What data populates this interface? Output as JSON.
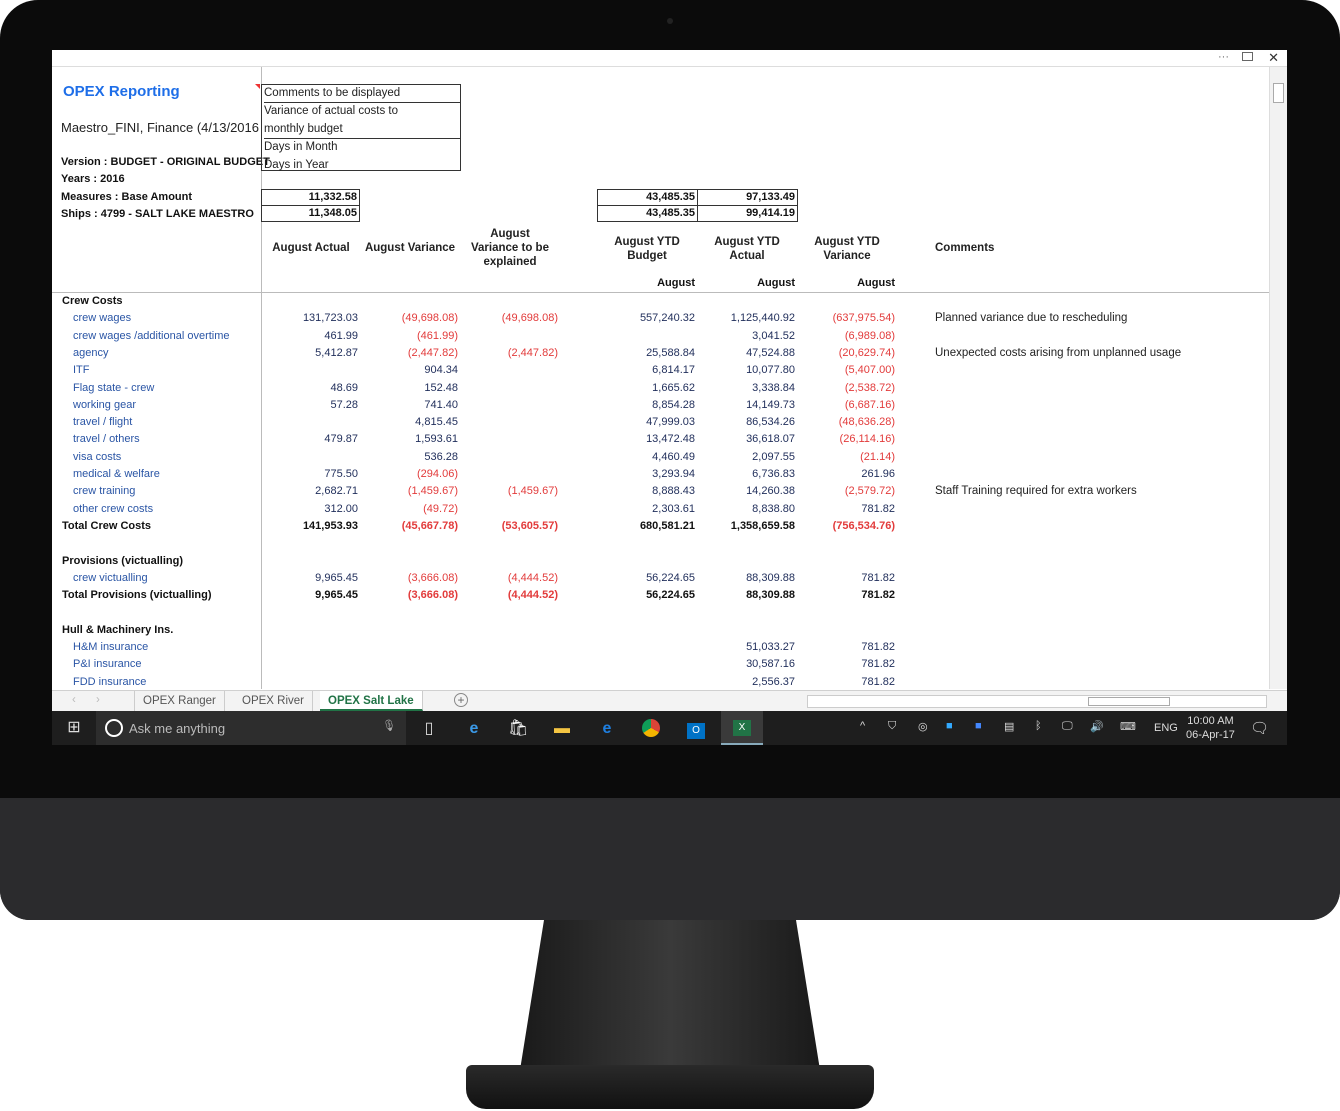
{
  "window": {
    "title_controls": [
      "...",
      "restore",
      "close"
    ]
  },
  "sheet": {
    "title": "OPEX Reporting",
    "subtitle": "Maestro_FINI, Finance (4/13/2016",
    "version": "Version : BUDGET - ORIGINAL BUDGET",
    "years": "Years : 2016",
    "measures": "Measures : Base Amount",
    "ships": "Ships : 4799 -  SALT LAKE MAESTRO",
    "legend": [
      "Comments to be displayed",
      "Variance of actual costs to",
      "monthly budget",
      "Days in Month",
      "Days in Year"
    ],
    "days_boxes": [
      "11,332.58",
      "11,348.05"
    ],
    "ytd_boxes": [
      [
        "43,485.35",
        "97,133.49"
      ],
      [
        "43,485.35",
        "99,414.19"
      ]
    ],
    "headers": {
      "actual": "August Actual",
      "variance": "August Variance",
      "explain": [
        "August",
        "Variance to be",
        "explained"
      ],
      "ytd_budget": [
        "August YTD",
        "Budget"
      ],
      "ytd_actual": [
        "August YTD",
        "Actual"
      ],
      "ytd_variance": [
        "August YTD",
        "Variance"
      ],
      "comments": "Comments",
      "sub": "August"
    },
    "rows": [
      {
        "label": "Crew Costs",
        "type": "section"
      },
      {
        "label": "crew wages",
        "v": [
          "131,723.03",
          "(49,698.08)",
          "(49,698.08)",
          "557,240.32",
          "1,125,440.92",
          "(637,975.54)"
        ],
        "comment": "Planned variance due to rescheduling"
      },
      {
        "label": "crew wages /additional overtime",
        "v": [
          "461.99",
          "(461.99)",
          "",
          "",
          "3,041.52",
          "(6,989.08)"
        ]
      },
      {
        "label": "agency",
        "v": [
          "5,412.87",
          "(2,447.82)",
          "(2,447.82)",
          "25,588.84",
          "47,524.88",
          "(20,629.74)"
        ],
        "comment": "Unexpected costs arising from unplanned usage"
      },
      {
        "label": "ITF",
        "v": [
          "",
          "904.34",
          "",
          "6,814.17",
          "10,077.80",
          "(5,407.00)"
        ]
      },
      {
        "label": "Flag state - crew",
        "v": [
          "48.69",
          "152.48",
          "",
          "1,665.62",
          "3,338.84",
          "(2,538.72)"
        ]
      },
      {
        "label": "working gear",
        "v": [
          "57.28",
          "741.40",
          "",
          "8,854.28",
          "14,149.73",
          "(6,687.16)"
        ]
      },
      {
        "label": "travel / flight",
        "v": [
          "",
          "4,815.45",
          "",
          "47,999.03",
          "86,534.26",
          "(48,636.28)"
        ]
      },
      {
        "label": "travel / others",
        "v": [
          "479.87",
          "1,593.61",
          "",
          "13,472.48",
          "36,618.07",
          "(26,114.16)"
        ]
      },
      {
        "label": "visa costs",
        "v": [
          "",
          "536.28",
          "",
          "4,460.49",
          "2,097.55",
          "(21.14)"
        ]
      },
      {
        "label": "medical & welfare",
        "v": [
          "775.50",
          "(294.06)",
          "",
          "3,293.94",
          "6,736.83",
          "261.96"
        ]
      },
      {
        "label": "crew training",
        "v": [
          "2,682.71",
          "(1,459.67)",
          "(1,459.67)",
          "8,888.43",
          "14,260.38",
          "(2,579.72)"
        ],
        "comment": "Staff Training required for extra workers"
      },
      {
        "label": "other crew costs",
        "v": [
          "312.00",
          "(49.72)",
          "",
          "2,303.61",
          "8,838.80",
          "781.82"
        ]
      },
      {
        "label": "Total Crew Costs",
        "type": "total",
        "v": [
          "141,953.93",
          "(45,667.78)",
          "(53,605.57)",
          "680,581.21",
          "1,358,659.58",
          "(756,534.76)"
        ]
      },
      {
        "label": "",
        "type": "blank"
      },
      {
        "label": "Provisions (victualling)",
        "type": "section"
      },
      {
        "label": "crew victualling",
        "v": [
          "9,965.45",
          "(3,666.08)",
          "(4,444.52)",
          "56,224.65",
          "88,309.88",
          "781.82"
        ]
      },
      {
        "label": "Total Provisions (victualling)",
        "type": "total",
        "v": [
          "9,965.45",
          "(3,666.08)",
          "(4,444.52)",
          "56,224.65",
          "88,309.88",
          "781.82"
        ]
      },
      {
        "label": "",
        "type": "blank"
      },
      {
        "label": "Hull & Machinery Ins.",
        "type": "section"
      },
      {
        "label": "H&M insurance",
        "v": [
          "",
          "",
          "",
          "",
          "51,033.27",
          "781.82"
        ]
      },
      {
        "label": "P&I insurance",
        "v": [
          "",
          "",
          "",
          "",
          "30,587.16",
          "781.82"
        ]
      },
      {
        "label": "FDD insurance",
        "v": [
          "",
          "",
          "",
          "",
          "2,556.37",
          "781.82"
        ]
      }
    ]
  },
  "sheet_tabs": [
    "OPEX Ranger",
    "OPEX River",
    "OPEX Salt Lake"
  ],
  "active_tab": "OPEX Salt Lake",
  "taskbar": {
    "search_placeholder": "Ask me anything",
    "language": "ENG",
    "time": "10:00 AM",
    "date": "06-Apr-17"
  },
  "colors": {
    "title": "#1e6ee8",
    "label": "#2a55a5",
    "negative": "#e23b3b",
    "excel_green": "#217346"
  }
}
